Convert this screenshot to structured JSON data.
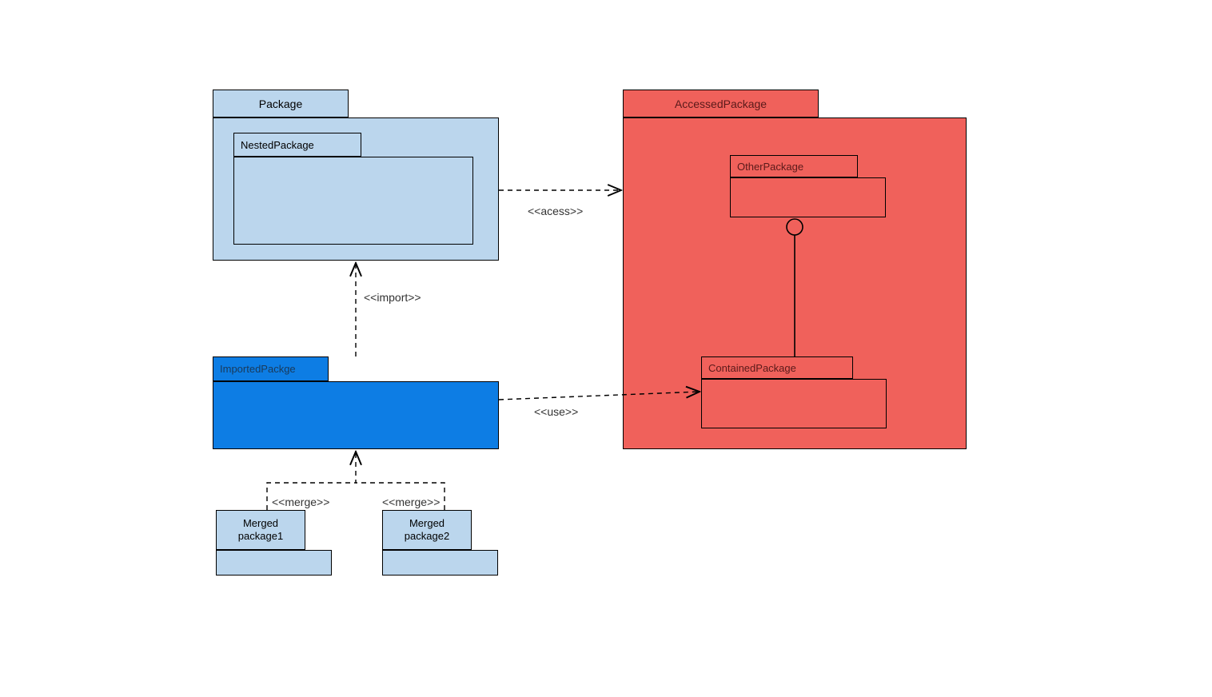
{
  "packages": {
    "package": {
      "label": "Package"
    },
    "nested": {
      "label": "NestedPackage"
    },
    "imported": {
      "label": "ImportedPackge"
    },
    "merged1_line1": "Merged",
    "merged1_line2": "package1",
    "merged2_line1": "Merged",
    "merged2_line2": "package2",
    "accessed": {
      "label": "AccessedPackage"
    },
    "other": {
      "label": "OtherPackage"
    },
    "contained": {
      "label": "ContainedPackage"
    }
  },
  "relations": {
    "access": "<<acess>>",
    "import": "<<import>>",
    "use": "<<use>>",
    "merge1": "<<merge>>",
    "merge2": "<<merge>>"
  }
}
